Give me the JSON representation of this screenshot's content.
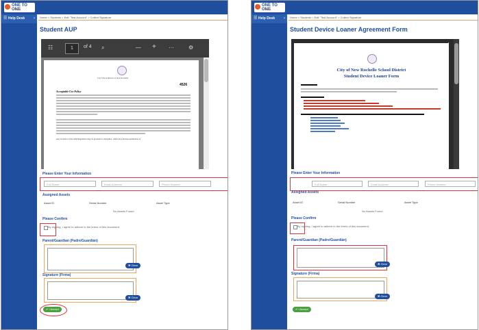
{
  "app": {
    "logo_name": "ONE TO ONE",
    "logo_sub": "PLUS"
  },
  "nav": {
    "help_desk": "Help Desk"
  },
  "breadcrumb": "Home > Students > Edit \"Test Account\" > Collect Signature",
  "left": {
    "title": "Student AUP",
    "pdf": {
      "page_value": "1",
      "page_total": "of 4",
      "doc_number": "4526",
      "doc_header": "City School District of New Rochelle",
      "section_title": "Acceptable Use Policy",
      "last_line": "Any violation of the AUP Regulation may be grounds for discipline, which may include termination of"
    },
    "info_label": "Please Enter Your Information",
    "inputs": {
      "full_name": "Full Name",
      "email": "Email Address",
      "phone": "Phone Number"
    },
    "assets_label": "Assigned Assets",
    "asset_cols": [
      "Asset ID",
      "Serial Number",
      "Asset Type"
    ],
    "no_assets": "No Assets Found",
    "confirm_label": "Please Confirm",
    "confirm_text": "By signing, I agree to adhere to the terms of this document.",
    "parent_label": "Parent/Guardian (Padre/Guardián)",
    "clear": "✖ Clear",
    "signature_label": "Signature (Firma)",
    "accept": "✔ I Accept"
  },
  "right": {
    "title": "Student Device Loaner Agreement Form",
    "doc_title_1": "City of New Rochelle School District",
    "doc_title_2": "Student Device Loaner Form",
    "info_label": "Please Enter Your Information",
    "inputs": {
      "full_name": "Full Name",
      "email": "Email Address",
      "phone": "Phone Number"
    },
    "assets_label": "Assigned Assets",
    "asset_cols": [
      "Asset ID",
      "Serial Number",
      "Asset Type"
    ],
    "no_assets": "No Assets Found",
    "confirm_label": "Please Confirm",
    "confirm_text": "By signing, I agree to adhere to the terms of this document.",
    "parent_label": "Parent/Guardian (Padre/Guardián)",
    "clear": "✖ Clear",
    "signature_label": "Signature (Firma)",
    "accept": "✔ I Accept"
  }
}
